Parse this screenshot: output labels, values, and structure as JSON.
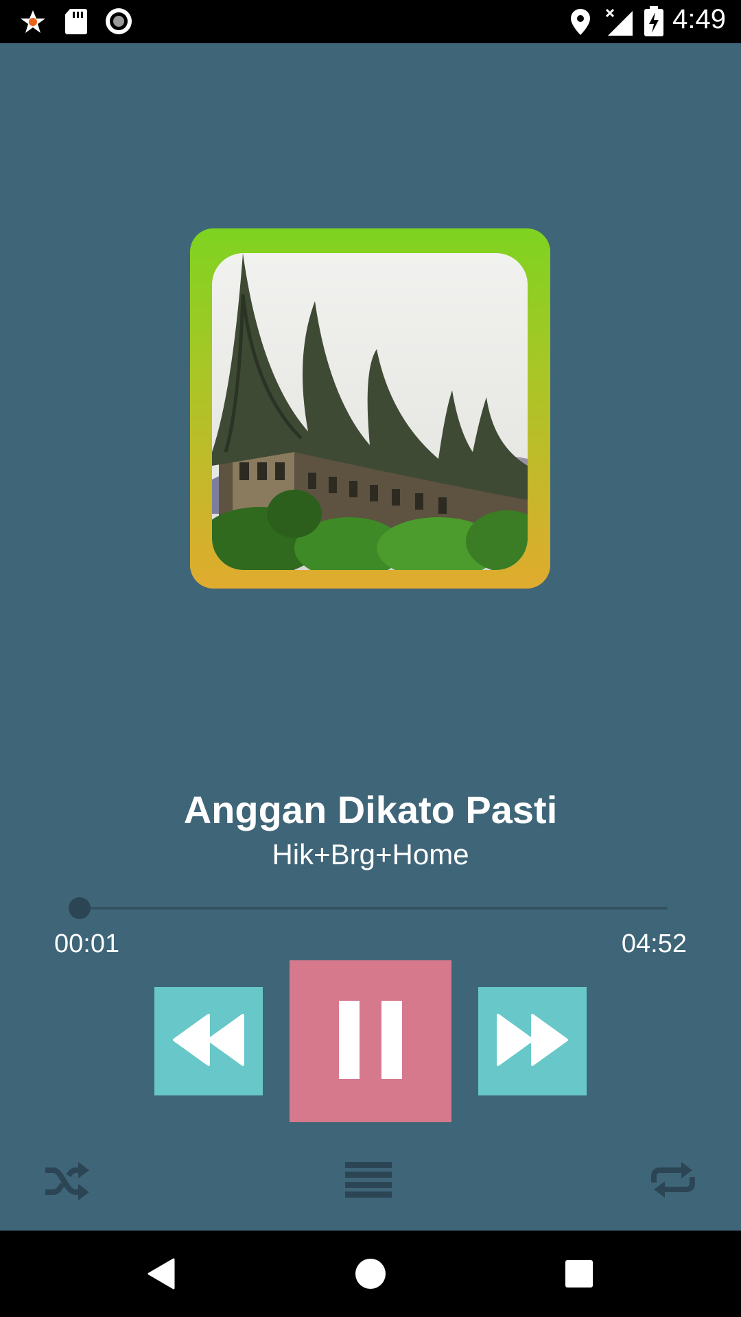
{
  "status_bar": {
    "time": "4:49",
    "left_icons": [
      "star-notification-icon",
      "sd-card-icon",
      "record-icon"
    ],
    "right_icons": [
      "location-icon",
      "signal-no-data-icon",
      "battery-charging-icon"
    ]
  },
  "player": {
    "track_title": "Anggan Dikato Pasti",
    "track_artist": "Hik+Brg+Home",
    "elapsed": "00:01",
    "duration": "04:52",
    "progress_fraction": 0.0034,
    "is_playing": true
  },
  "controls": {
    "rewind_icon": "rewind-icon",
    "pause_icon": "pause-icon",
    "fast_forward_icon": "fast-forward-icon",
    "shuffle_icon": "shuffle-icon",
    "playlist_icon": "playlist-icon",
    "repeat_icon": "repeat-icon"
  },
  "colors": {
    "background": "#3f6578",
    "skip_button": "#68c7c8",
    "pause_button": "#d6798c",
    "album_frame_top": "#7ed321",
    "album_frame_bottom": "#e0ab2e",
    "secondary_icon": "#2c4555"
  },
  "nav_bar": {
    "icons": [
      "back-icon",
      "home-icon",
      "recents-icon"
    ]
  }
}
